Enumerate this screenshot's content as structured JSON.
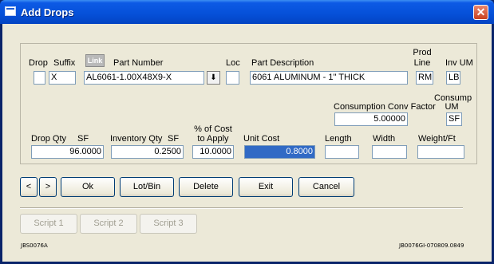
{
  "window": {
    "title": "Add Drops",
    "close_glyph": "✕"
  },
  "labels": {
    "drop": "Drop",
    "suffix": "Suffix",
    "link": "Link",
    "part_number": "Part Number",
    "loc": "Loc",
    "part_description": "Part Description",
    "prod_line_1": "Prod",
    "prod_line_2": "Line",
    "inv_um": "Inv UM",
    "consumption_conv_factor": "Consumption Conv Factor",
    "consump_um_1": "Consump",
    "consump_um_2": "UM",
    "drop_qty": "Drop Qty",
    "drop_qty_unit": "SF",
    "inventory_qty": "Inventory Qty",
    "inventory_qty_unit": "SF",
    "pct_cost_1": "% of Cost",
    "pct_cost_2": "to Apply",
    "unit_cost": "Unit Cost",
    "length": "Length",
    "width": "Width",
    "weight_ft": "Weight/Ft"
  },
  "fields": {
    "drop": "",
    "suffix": "X",
    "part_number": "AL6061-1.00X48X9-X",
    "loc": "",
    "part_description": "6061 ALUMINUM - 1\" THICK",
    "prod_line": "RM",
    "inv_um": "LB",
    "consumption_conv_factor": "5.00000",
    "consump_um": "SF",
    "drop_qty": "96.0000",
    "inventory_qty": "0.2500",
    "pct_cost": "10.0000",
    "unit_cost": "0.8000",
    "length": "",
    "width": "",
    "weight_ft": ""
  },
  "buttons": {
    "prev": "<",
    "next": ">",
    "ok": "Ok",
    "lot_bin": "Lot/Bin",
    "delete": "Delete",
    "exit": "Exit",
    "cancel": "Cancel",
    "script1": "Script 1",
    "script2": "Script 2",
    "script3": "Script 3"
  },
  "footer": {
    "left_code": "JBS0076A",
    "right_code": "JB0076GI-070809.0849"
  },
  "icons": {
    "dropdown": "⬇"
  }
}
